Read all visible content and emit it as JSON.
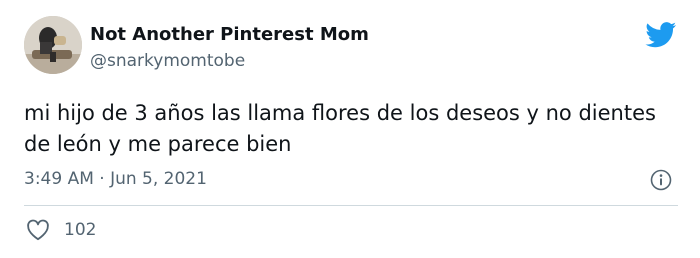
{
  "tweet": {
    "author_name": "Not Another Pinterest Mom",
    "author_handle": "@snarkymomtobe",
    "text": "mi hijo de 3 años las llama flores de los deseos y no dientes de león y me parece bien",
    "timestamp": "3:49 AM · Jun 5, 2021",
    "like_count": "102"
  },
  "icons": {
    "brand": "twitter-bird-icon",
    "info": "info-icon",
    "like": "heart-icon"
  },
  "colors": {
    "brand_blue": "#1d9bf0",
    "text_primary": "#0f1419",
    "text_secondary": "#536471",
    "divider": "#cfd9de"
  }
}
